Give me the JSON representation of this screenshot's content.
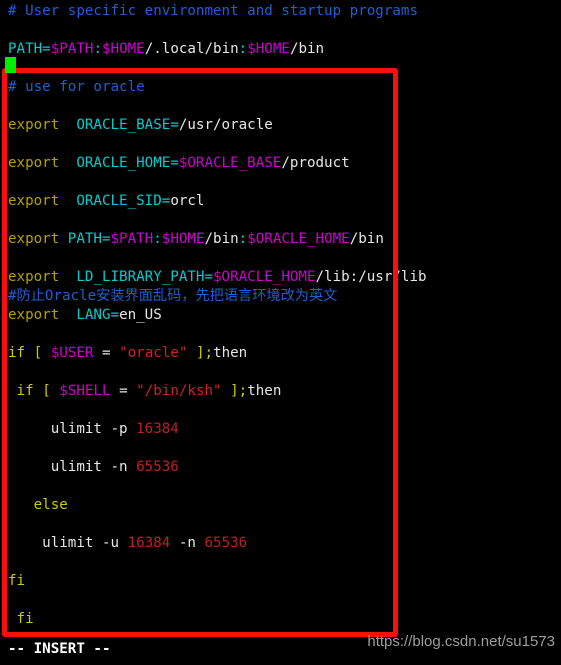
{
  "editor": {
    "mode_label": "-- INSERT --",
    "watermark": "https://blog.csdn.net/su1573",
    "cursor": {
      "name": "block-cursor",
      "color": "#00ef00"
    },
    "annotation_box": {
      "name": "red-highlight-rectangle",
      "color": "#fb0d10"
    },
    "colors": {
      "background": "#000000",
      "comment": "#1f5fd0",
      "keyword": "#cdcd00",
      "export": "#b5a000",
      "identifier": "#00cdcd",
      "variable": "#cd00cd",
      "text": "#e6e6e6",
      "string": "#cc2222",
      "number": "#bb2222",
      "status_text": "#ffffff",
      "watermark": "#9d9d9d"
    }
  },
  "lines": [
    {
      "id": 1,
      "text": "# User specific environment and startup programs"
    },
    {
      "id": 2,
      "text": ""
    },
    {
      "id": 3,
      "text": "PATH=$PATH:$HOME/.local/bin:$HOME/bin"
    },
    {
      "id": 4,
      "text": ""
    },
    {
      "id": 5,
      "text": "# use for oracle"
    },
    {
      "id": 6,
      "text": ""
    },
    {
      "id": 7,
      "text": "export  ORACLE_BASE=/usr/oracle"
    },
    {
      "id": 8,
      "text": ""
    },
    {
      "id": 9,
      "text": "export  ORACLE_HOME=$ORACLE_BASE/product"
    },
    {
      "id": 10,
      "text": ""
    },
    {
      "id": 11,
      "text": "export  ORACLE_SID=orcl"
    },
    {
      "id": 12,
      "text": ""
    },
    {
      "id": 13,
      "text": "export PATH=$PATH:$HOME/bin:$ORACLE_HOME/bin"
    },
    {
      "id": 14,
      "text": ""
    },
    {
      "id": 15,
      "text": "export LD_LIBRARY_PATH=$ORACLE_HOME/lib:/usr/lib"
    },
    {
      "id": 16,
      "text": "#防止Oracle安装界面乱码，先把语言环境改为英文"
    },
    {
      "id": 17,
      "text": "export LANG=en_US"
    },
    {
      "id": 18,
      "text": ""
    },
    {
      "id": 19,
      "text": "if [ $USER = \"oracle\" ];then"
    },
    {
      "id": 20,
      "text": ""
    },
    {
      "id": 21,
      "text": " if [ $SHELL = \"/bin/ksh\" ];then"
    },
    {
      "id": 22,
      "text": ""
    },
    {
      "id": 23,
      "text": "     ulimit -p 16384"
    },
    {
      "id": 24,
      "text": ""
    },
    {
      "id": 25,
      "text": "     ulimit -n 65536"
    },
    {
      "id": 26,
      "text": ""
    },
    {
      "id": 27,
      "text": "   else"
    },
    {
      "id": 28,
      "text": ""
    },
    {
      "id": 29,
      "text": "    ulimit -u 16384 -n 65536"
    },
    {
      "id": 30,
      "text": ""
    },
    {
      "id": 31,
      "text": "fi"
    },
    {
      "id": 32,
      "text": ""
    },
    {
      "id": 33,
      "text": " fi"
    }
  ],
  "tokens": [
    {
      "line": 1,
      "spans": [
        [
          "cmt",
          "# User specific environment and startup programs"
        ]
      ]
    },
    {
      "line": 2,
      "spans": []
    },
    {
      "line": 3,
      "spans": [
        [
          "ident",
          "PATH="
        ],
        [
          "var",
          "$PATH"
        ],
        [
          "ident",
          ":"
        ],
        [
          "var",
          "$HOME"
        ],
        [
          "txt",
          "/.local/bin"
        ],
        [
          "ident",
          ":"
        ],
        [
          "var",
          "$HOME"
        ],
        [
          "txt",
          "/bin"
        ]
      ]
    },
    {
      "line": 4,
      "spans": []
    },
    {
      "line": 5,
      "spans": [
        [
          "cmt",
          "# use for oracle"
        ]
      ]
    },
    {
      "line": 6,
      "spans": []
    },
    {
      "line": 7,
      "spans": [
        [
          "exp",
          "export"
        ],
        [
          "txt",
          "  "
        ],
        [
          "ident",
          "ORACLE_BASE="
        ],
        [
          "txt",
          "/usr/oracle"
        ]
      ]
    },
    {
      "line": 8,
      "spans": []
    },
    {
      "line": 9,
      "spans": [
        [
          "exp",
          "export"
        ],
        [
          "txt",
          "  "
        ],
        [
          "ident",
          "ORACLE_HOME="
        ],
        [
          "var",
          "$ORACLE_BASE"
        ],
        [
          "txt",
          "/product"
        ]
      ]
    },
    {
      "line": 10,
      "spans": []
    },
    {
      "line": 11,
      "spans": [
        [
          "exp",
          "export"
        ],
        [
          "txt",
          "  "
        ],
        [
          "ident",
          "ORACLE_SID="
        ],
        [
          "txt",
          "orcl"
        ]
      ]
    },
    {
      "line": 12,
      "spans": []
    },
    {
      "line": 13,
      "spans": [
        [
          "exp",
          "export"
        ],
        [
          "txt",
          " "
        ],
        [
          "ident",
          "PATH="
        ],
        [
          "var",
          "$PATH"
        ],
        [
          "ident",
          ":"
        ],
        [
          "var",
          "$HOME"
        ],
        [
          "txt",
          "/bin"
        ],
        [
          "ident",
          ":"
        ],
        [
          "var",
          "$ORACLE_HOME"
        ],
        [
          "txt",
          "/bin"
        ]
      ]
    },
    {
      "line": 14,
      "spans": []
    },
    {
      "line": 15,
      "spans": [
        [
          "exp",
          "export"
        ],
        [
          "txt",
          "  "
        ],
        [
          "ident",
          "LD_LIBRARY_PATH="
        ],
        [
          "var",
          "$ORACLE_HOME"
        ],
        [
          "txt",
          "/lib:/usr/lib"
        ]
      ]
    },
    {
      "line": 16,
      "spans": [
        [
          "cmt",
          "#防止Oracle安装界面乱码，先把语言环境改为英文"
        ]
      ]
    },
    {
      "line": 17,
      "spans": [
        [
          "exp",
          "export"
        ],
        [
          "txt",
          "  "
        ],
        [
          "ident",
          "LANG="
        ],
        [
          "txt",
          "en_US"
        ]
      ]
    },
    {
      "line": 18,
      "spans": []
    },
    {
      "line": 19,
      "spans": [
        [
          "kw",
          "if"
        ],
        [
          "txt",
          " "
        ],
        [
          "kw",
          "["
        ],
        [
          "txt",
          " "
        ],
        [
          "var",
          "$USER"
        ],
        [
          "txt",
          " = "
        ],
        [
          "str",
          "\"oracle\""
        ],
        [
          "txt",
          " "
        ],
        [
          "kw",
          "]"
        ],
        [
          "kw",
          ";"
        ],
        [
          "txt",
          "then"
        ]
      ]
    },
    {
      "line": 20,
      "spans": []
    },
    {
      "line": 21,
      "spans": [
        [
          "txt",
          " "
        ],
        [
          "kw",
          "if"
        ],
        [
          "txt",
          " "
        ],
        [
          "kw",
          "["
        ],
        [
          "txt",
          " "
        ],
        [
          "var",
          "$SHELL"
        ],
        [
          "txt",
          " = "
        ],
        [
          "str",
          "\"/bin/ksh\""
        ],
        [
          "txt",
          " "
        ],
        [
          "kw",
          "]"
        ],
        [
          "kw",
          ";"
        ],
        [
          "txt",
          "then"
        ]
      ]
    },
    {
      "line": 22,
      "spans": []
    },
    {
      "line": 23,
      "spans": [
        [
          "txt",
          "     ulimit -p "
        ],
        [
          "num",
          "16384"
        ]
      ]
    },
    {
      "line": 24,
      "spans": []
    },
    {
      "line": 25,
      "spans": [
        [
          "txt",
          "     ulimit -n "
        ],
        [
          "num",
          "65536"
        ]
      ]
    },
    {
      "line": 26,
      "spans": []
    },
    {
      "line": 27,
      "spans": [
        [
          "txt",
          "   "
        ],
        [
          "kw",
          "else"
        ]
      ]
    },
    {
      "line": 28,
      "spans": []
    },
    {
      "line": 29,
      "spans": [
        [
          "txt",
          "    ulimit -u "
        ],
        [
          "num",
          "16384"
        ],
        [
          "txt",
          " -n "
        ],
        [
          "num",
          "65536"
        ]
      ]
    },
    {
      "line": 30,
      "spans": []
    },
    {
      "line": 31,
      "spans": [
        [
          "kw",
          "fi"
        ]
      ]
    },
    {
      "line": 32,
      "spans": []
    },
    {
      "line": 33,
      "spans": [
        [
          "txt",
          " "
        ],
        [
          "kw",
          "fi"
        ]
      ]
    }
  ]
}
